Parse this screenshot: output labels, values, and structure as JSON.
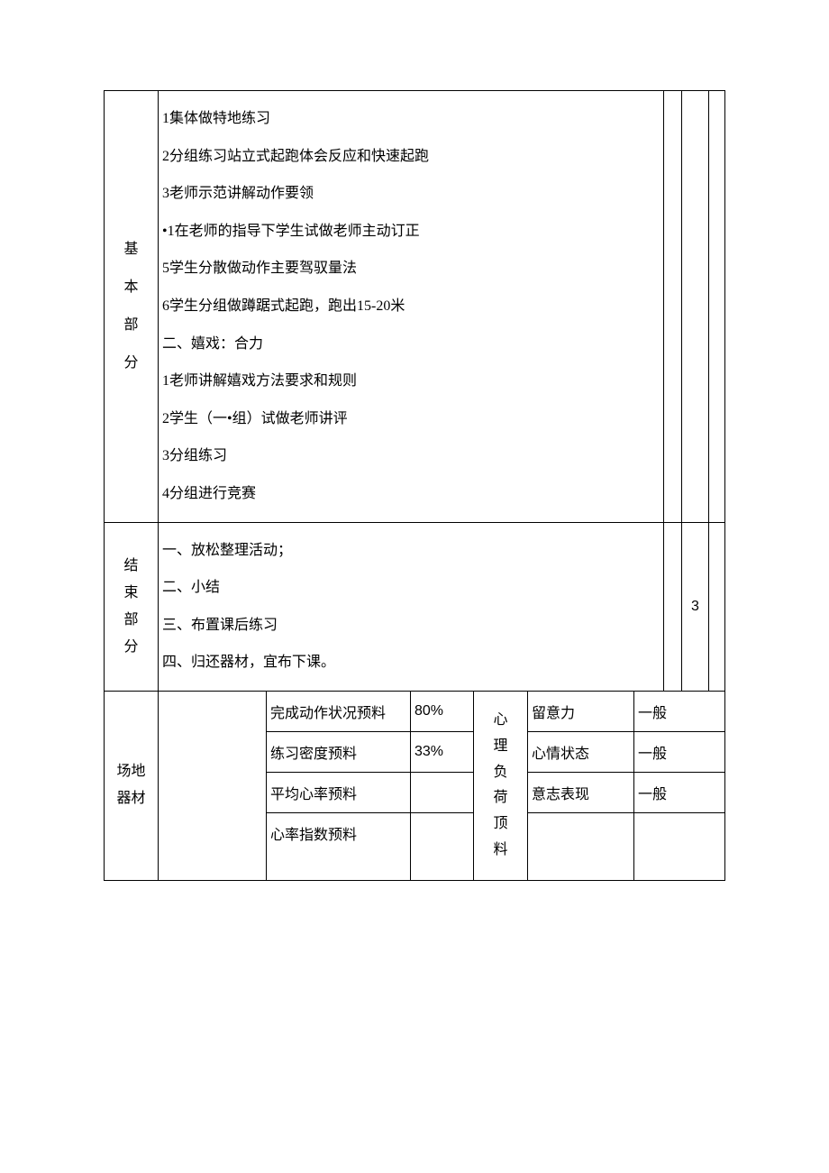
{
  "section1": {
    "label_chars": [
      "基",
      "本",
      "部",
      "分"
    ],
    "lines": [
      "1集体做特地练习",
      "2分组练习站立式起跑体会反应和快速起跑",
      "3老师示范讲解动作要领",
      "•1在老师的指导下学生试做老师主动订正",
      "5学生分散做动作主要驾驭量法",
      "6学生分组做蹲踞式起跑，跑出15-20米",
      "二、嬉戏：合力",
      "1老师讲解嬉戏方法要求和规则",
      "2学生（一•组）试做老师讲评",
      "3分组练习",
      "4分组进行竞赛"
    ]
  },
  "section2": {
    "label_chars": [
      "结",
      "束",
      "部",
      "分"
    ],
    "lines": [
      "一、放松整理活动；",
      "二、小结",
      "三、布置课后练习",
      "四、归还器材，宜布下课。"
    ],
    "num": "3"
  },
  "lower": {
    "row1_label_chars": [
      "场地",
      "器材"
    ],
    "metrics": [
      {
        "label": "完成动作状况预料",
        "value": "80%"
      },
      {
        "label": "练习密度预料",
        "value": "33%"
      },
      {
        "label": "平均心率预料",
        "value": ""
      },
      {
        "label": "心率指数预料",
        "value": ""
      }
    ],
    "mid_label_chars": [
      "心",
      "理",
      "负",
      "荷",
      "顶",
      "料"
    ],
    "right": [
      {
        "label": "留意力",
        "value": "一般"
      },
      {
        "label": "心情状态",
        "value": "一般"
      },
      {
        "label": "意志表现",
        "value": "一般"
      },
      {
        "label": "",
        "value": ""
      }
    ]
  }
}
